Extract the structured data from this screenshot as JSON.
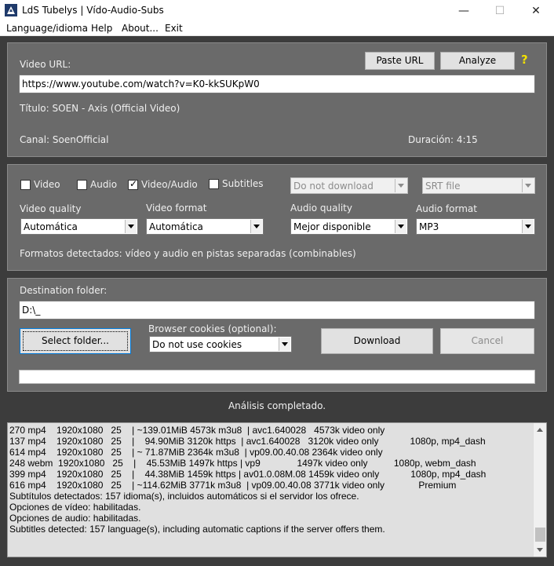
{
  "window": {
    "title": "LdS Tubelys  |  Vído-Audio-Subs",
    "minimize": "—",
    "maximize": "☐",
    "close": "✕"
  },
  "menu": {
    "language": "Language/idioma",
    "help": "Help",
    "about": "About...",
    "exit": "Exit"
  },
  "url_section": {
    "label": "Video URL:",
    "value": "https://www.youtube.com/watch?v=K0-kkSUKpW0",
    "paste_button": "Paste URL",
    "analyze_button": "Analyze",
    "help_mark": "?",
    "title_info": "Título: SOEN - Axis (Official Video)",
    "channel_info": "Canal: SoenOfficial",
    "duration_info": "Duración: 4:15"
  },
  "options": {
    "video_check": "Video",
    "audio_check": "Audio",
    "videoaudio_check": "Video/Audio",
    "subtitles_check": "Subtitles",
    "subs_select": "Do not download",
    "subs_format_select": "SRT file",
    "video_quality_label": "Video quality",
    "video_quality_value": "Automática",
    "video_format_label": "Video format",
    "video_format_value": "Automática",
    "audio_quality_label": "Audio quality",
    "audio_quality_value": "Mejor disponible",
    "audio_format_label": "Audio format",
    "audio_format_value": "MP3",
    "formats_detected": "Formatos detectados: vídeo y audio en pistas separadas (combinables)"
  },
  "destination": {
    "label": "Destination folder:",
    "value": "D:\\_",
    "select_button": "Select folder...",
    "cookies_label": "Browser cookies (optional):",
    "cookies_value": "Do not use cookies",
    "download_button": "Download",
    "cancel_button": "Cancel",
    "progress_fraction": 0
  },
  "status": "Análisis completado.",
  "log": [
    "270 mp4    1920x1080   25    | ~139.01MiB 4573k m3u8  | avc1.640028   4573k video only",
    "137 mp4    1920x1080   25    |    94.90MiB 3120k https  | avc1.640028   3120k video only            1080p, mp4_dash",
    "614 mp4    1920x1080   25    | ~ 71.87MiB 2364k m3u8  | vp09.00.40.08 2364k video only",
    "248 webm  1920x1080   25    |    45.53MiB 1497k https | vp9              1497k video only          1080p, webm_dash",
    "399 mp4    1920x1080   25    |    44.38MiB 1459k https | av01.0.08M.08 1459k video only            1080p, mp4_dash",
    "616 mp4    1920x1080   25    | ~114.62MiB 3771k m3u8  | vp09.00.40.08 3771k video only             Premium",
    "Subtítulos detectados: 157 idioma(s), incluidos automáticos si el servidor los ofrece.",
    "Opciones de vídeo: habilitadas.",
    "Opciones de audio: habilitadas.",
    "Subtitles detected: 157 language(s), including automatic captions if the server offers them."
  ]
}
